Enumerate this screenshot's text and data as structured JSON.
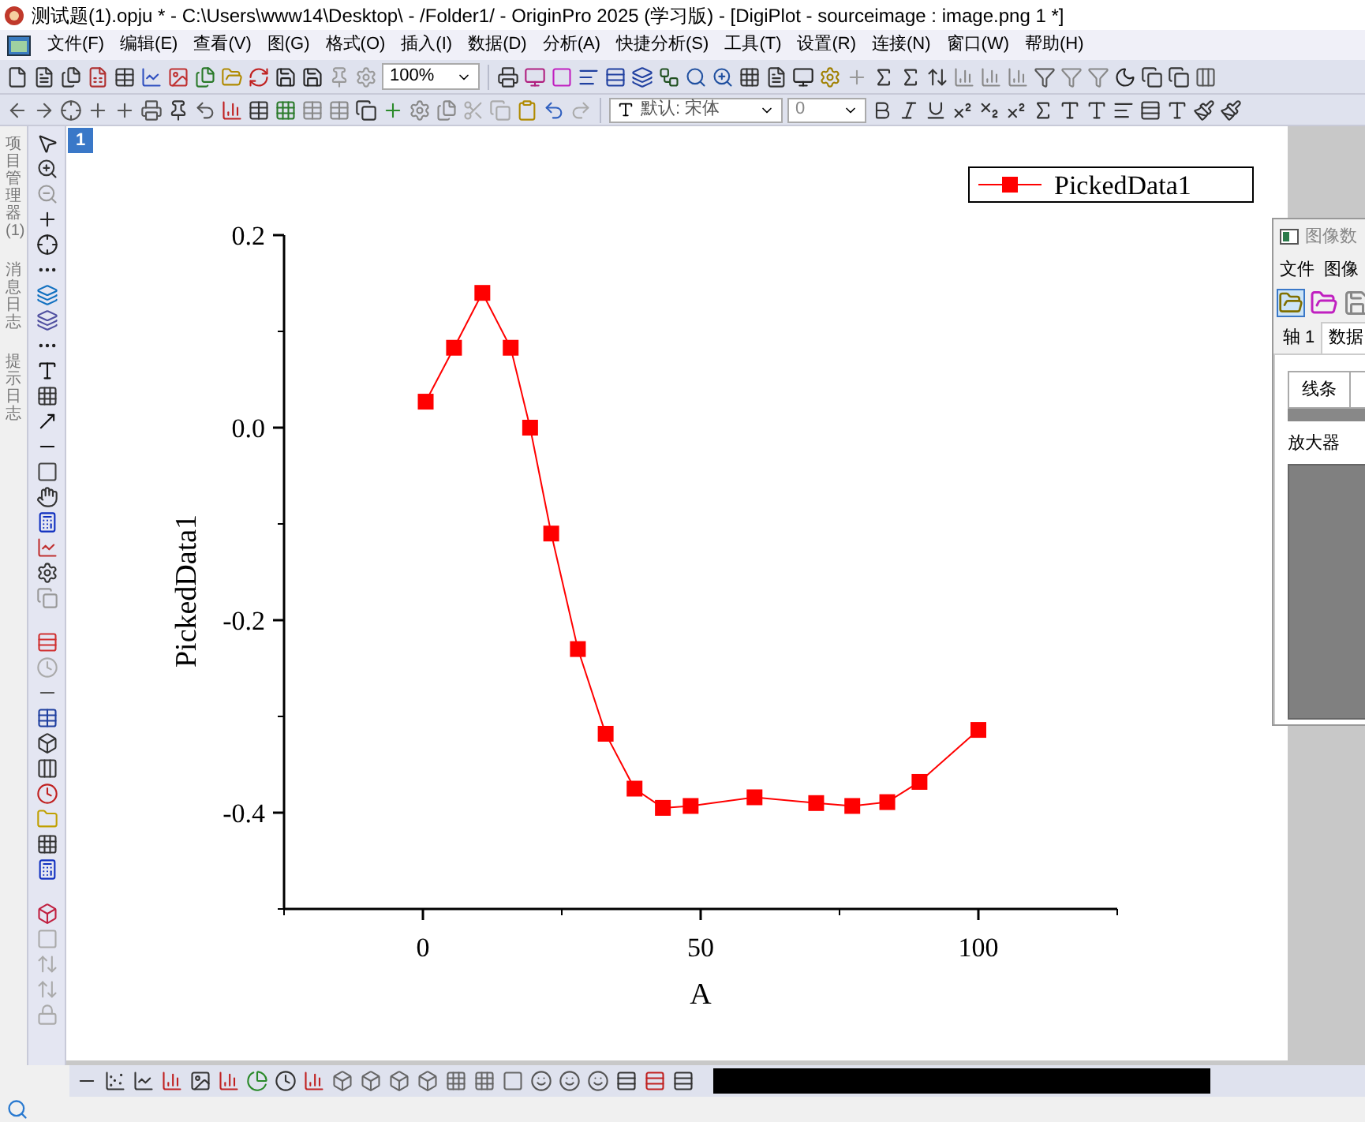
{
  "title_bar": {
    "title": "测试题(1).opju * - C:\\Users\\www14\\Desktop\\ - /Folder1/ - OriginPro 2025 (学习版) - [DigiPlot - sourceimage : image.png 1 *]"
  },
  "menu": [
    "文件(F)",
    "编辑(E)",
    "查看(V)",
    "图(G)",
    "格式(O)",
    "插入(I)",
    "数据(D)",
    "分析(A)",
    "快捷分析(S)",
    "工具(T)",
    "设置(R)",
    "连接(N)",
    "窗口(W)",
    "帮助(H)"
  ],
  "toolbar": {
    "zoom": "100%",
    "font": "默认: 宋体",
    "font_size": "0"
  },
  "side_tabs": [
    "项目管理器 (1)",
    "消息日志",
    "提示日志"
  ],
  "graph": {
    "page_label": "1",
    "chart_data": {
      "type": "line",
      "xlabel": "A",
      "ylabel": "PickedData1",
      "x": [
        0.5,
        5.6,
        10.7,
        15.8,
        19.3,
        23.1,
        27.9,
        32.9,
        38.1,
        43.2,
        48.2,
        59.7,
        70.8,
        77.3,
        83.6,
        89.4,
        100
      ],
      "series": [
        {
          "name": "PickedData1",
          "color": "#ff0000",
          "marker": "square",
          "values": [
            0.027,
            0.083,
            0.14,
            0.083,
            0.0,
            -0.11,
            -0.23,
            -0.318,
            -0.375,
            -0.395,
            -0.393,
            -0.384,
            -0.39,
            -0.393,
            -0.389,
            -0.368,
            -0.314
          ]
        }
      ],
      "xlim": [
        -25,
        125
      ],
      "ylim": [
        -0.5,
        0.2
      ],
      "xticks": [
        0,
        50,
        100
      ],
      "yticks": [
        {
          "value": 0.2,
          "label": "0.2"
        },
        {
          "value": 0,
          "label": "0.0"
        },
        {
          "value": -0.2,
          "label": "-0.2"
        },
        {
          "value": -0.4,
          "label": "-0.4"
        }
      ]
    }
  },
  "digitizer": {
    "title": "图像数",
    "menu": [
      "文件",
      "图像"
    ],
    "tabs": [
      {
        "label": "轴 1",
        "selected": false
      },
      {
        "label": "数据",
        "selected": true
      }
    ],
    "table": {
      "columns": [
        "线条"
      ]
    },
    "magnifier_label": "放大器"
  }
}
